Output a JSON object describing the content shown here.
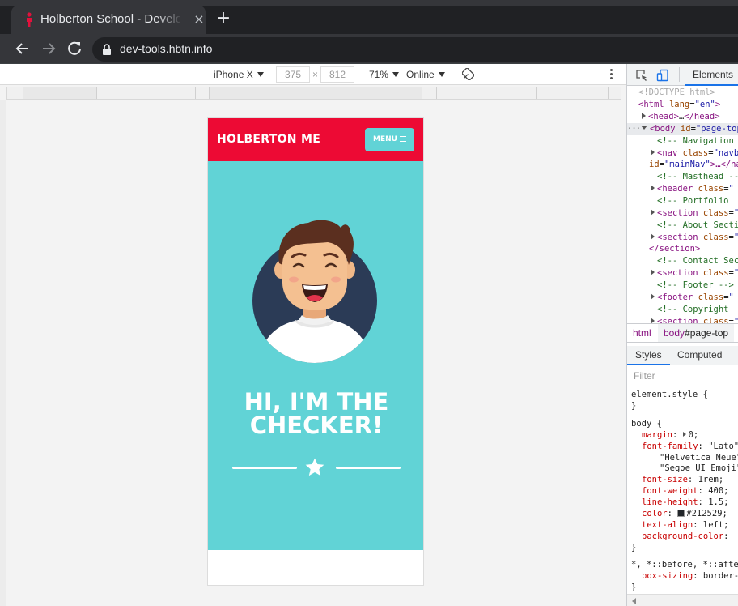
{
  "browser": {
    "tab_title": "Holberton School - Developer Tools",
    "url": "dev-tools.hbtn.info"
  },
  "device_toolbar": {
    "device": "iPhone X",
    "width": "375",
    "times": "×",
    "height": "812",
    "zoom": "71%",
    "network": "Online"
  },
  "site": {
    "brand": "HOLBERTON ME",
    "menu_label": "MENU",
    "headline_line1": "HI, I'M THE",
    "headline_line2": "CHECKER!"
  },
  "devtools": {
    "active_tab": "Elements",
    "dom": {
      "doctype": "<!DOCTYPE html>",
      "html_open_tag": "<html",
      "html_lang_attr": "lang",
      "html_lang_val": "\"en\"",
      "html_close_bracket": ">",
      "head_tag": "<head>",
      "head_ellipsis": "…",
      "head_close": "</head>",
      "body_tag": "<body",
      "body_id_attr": "id",
      "body_id_val": "\"page-top\"",
      "comment_nav": "<!-- Navigation -->",
      "nav_tag": "<nav",
      "nav_class_attr": "class",
      "nav_class_val": "\"navbar\"",
      "nav_id_attr": "id",
      "nav_id_val": "\"mainNav\"",
      "nav_tail": ">…</nav>",
      "comment_masthead": "<!-- Masthead -->",
      "header_tag": "<header",
      "header_class_attr": "class",
      "header_class_val": "\"",
      "comment_portfolio": "<!-- Portfolio",
      "section_tag": "<section",
      "section_class_attr": "class",
      "section_class_val": "\"",
      "comment_about": "<!-- About Section",
      "section_close": "</section>",
      "comment_contact": "<!-- Contact Section",
      "comment_footer": "<!-- Footer -->",
      "footer_tag": "<footer",
      "footer_class_attr": "class",
      "footer_class_val": "\"",
      "comment_copyright": "<!-- Copyright",
      "ellipsis": "…"
    },
    "breadcrumbs": [
      {
        "tag": "html",
        "id": ""
      },
      {
        "tag": "body",
        "id": "#page-top"
      }
    ],
    "sub_tabs": [
      "Styles",
      "Computed"
    ],
    "filter_placeholder": "Filter",
    "styles": {
      "element_style_selector": "element.style {",
      "close_brace": "}",
      "body_selector": "body",
      "open_brace": "{",
      "margin_prop": "margin",
      "margin_val": "0;",
      "font_family_prop": "font-family",
      "font_family_val": "\"Lato\",",
      "font_family_cont1": "\"Helvetica Neue\",",
      "font_family_cont2": "\"Segoe UI Emoji\";",
      "font_size_prop": "font-size",
      "font_size_val": "1rem;",
      "font_weight_prop": "font-weight",
      "font_weight_val": "400;",
      "line_height_prop": "line-height",
      "line_height_val": "1.5;",
      "color_prop": "color",
      "color_val": "#212529;",
      "text_align_prop": "text-align",
      "text_align_val": "left;",
      "bg_color_prop": "background-color",
      "bg_color_val": "",
      "universal_selector": "*, *::before, *::after",
      "box_sizing_prop": "box-sizing",
      "box_sizing_val": "border-box;"
    }
  },
  "colors": {
    "site_red": "#ed0a34",
    "site_teal": "#61d3d6",
    "avatar_navy": "#2b3b56",
    "chrome_dark": "#202124",
    "devtools_accent": "#1a73e8"
  },
  "icons": [
    "red-figure-favicon",
    "close-icon",
    "plus-icon",
    "back-arrow-icon",
    "forward-arrow-icon",
    "reload-icon",
    "lock-icon",
    "rotate-icon",
    "more-vert-icon",
    "inspect-icon",
    "device-toggle-icon",
    "star-icon",
    "hamburger-icon"
  ]
}
